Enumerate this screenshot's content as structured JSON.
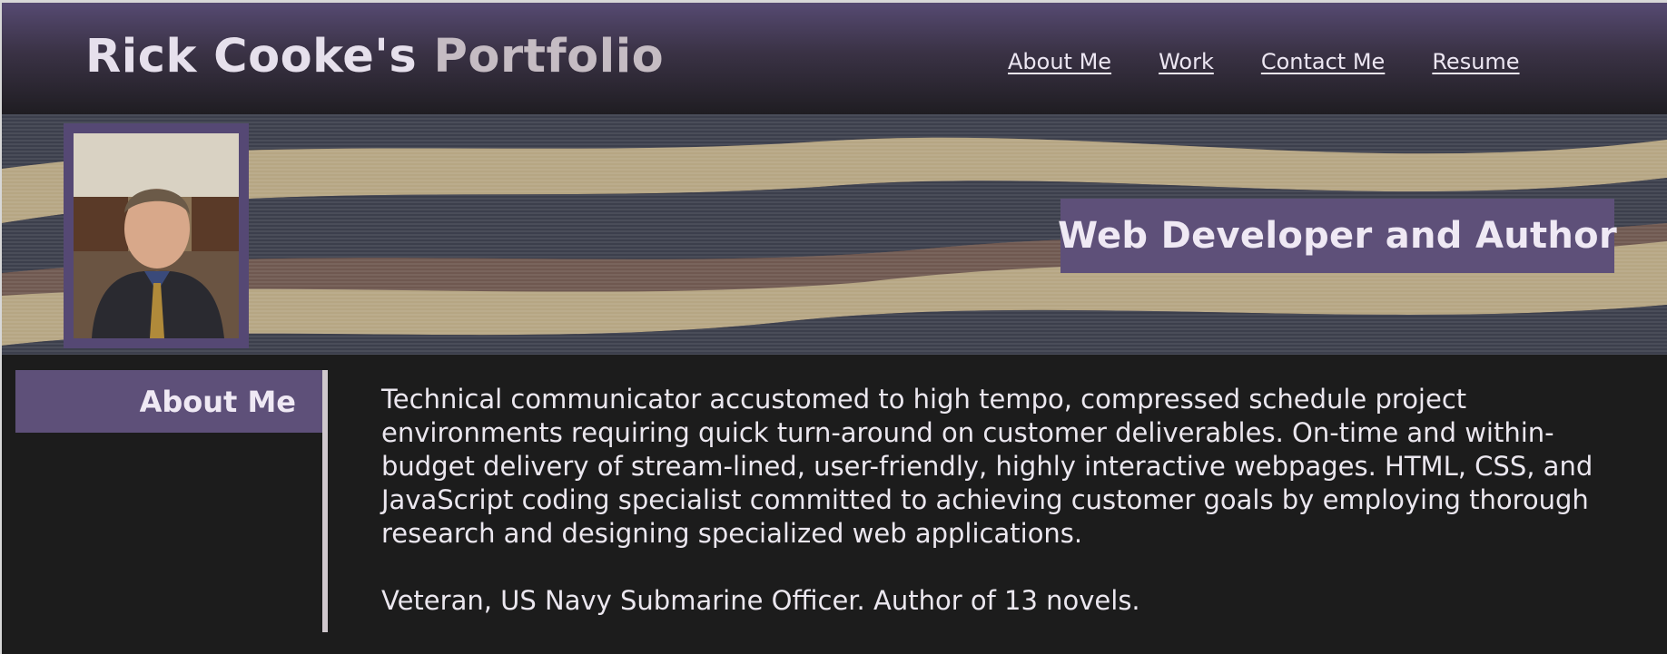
{
  "header": {
    "title_main": "Rick Cooke's",
    "title_accent": "Portfolio",
    "nav": [
      {
        "label": "About Me"
      },
      {
        "label": "Work"
      },
      {
        "label": "Contact Me"
      },
      {
        "label": "Resume"
      }
    ]
  },
  "hero": {
    "tagline": "Web Developer and Author",
    "profile_photo": "portrait-photo"
  },
  "about": {
    "heading": "About Me",
    "paragraphs": [
      "Technical communicator accustomed to high tempo, compressed schedule project environments requiring quick turn-around on customer deliverables. On-time and within-budget delivery of stream-lined, user-friendly, highly interactive webpages. HTML, CSS, and JavaScript coding specialist committed to achieving customer goals by employing thorough research and designing specialized web applications.",
      "Veteran, US Navy Submarine Officer. Author of 13 novels."
    ]
  },
  "colors": {
    "accent_purple": "#5e5079",
    "background": "#1c1c1c",
    "banner_beige": "#b6a683",
    "banner_slate": "#3c3f4c",
    "banner_brown": "#6f5850"
  }
}
